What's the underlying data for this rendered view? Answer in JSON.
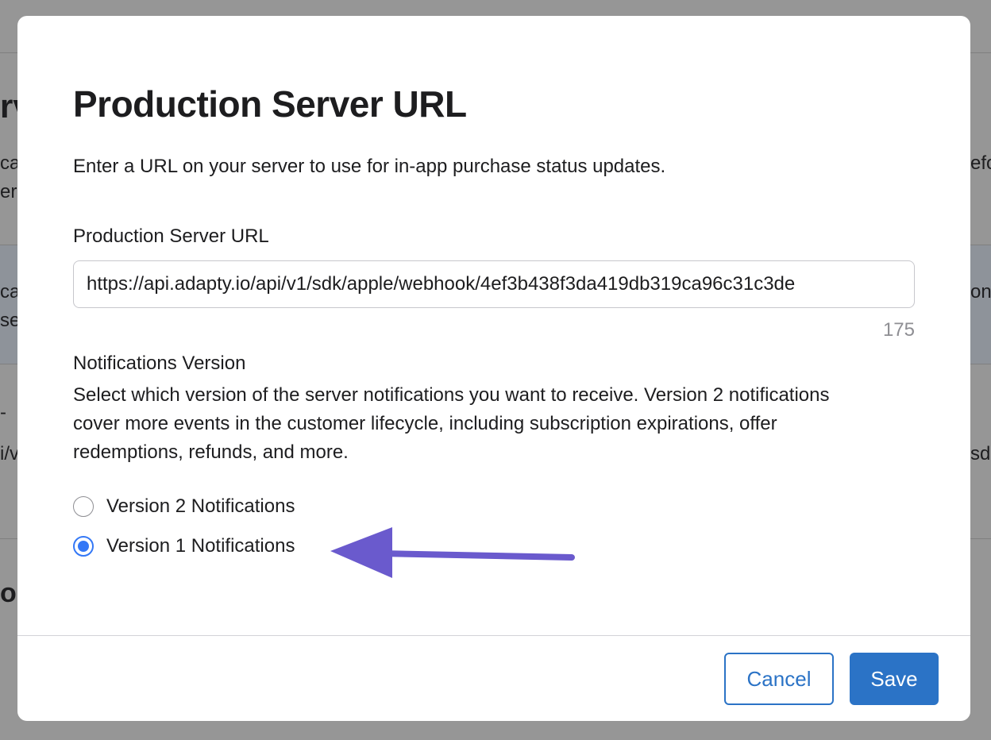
{
  "dialog": {
    "title": "Production Server URL",
    "description": "Enter a URL on your server to use for in-app purchase status updates.",
    "url_field": {
      "label": "Production Server URL",
      "value": "https://api.adapty.io/api/v1/sdk/apple/webhook/4ef3b438f3da419db319ca96c31c3de",
      "char_count": "175"
    },
    "notifications": {
      "title": "Notifications Version",
      "description": "Select which version of the server notifications you want to receive. Version 2 notifications cover more events in the customer lifecycle, including subscription expirations, offer redemptions, refunds, and more.",
      "options": [
        {
          "label": "Version 2 Notifications",
          "selected": false
        },
        {
          "label": "Version 1 Notifications",
          "selected": true
        }
      ]
    },
    "buttons": {
      "cancel": "Cancel",
      "save": "Save"
    }
  },
  "background": {
    "fragments": [
      "rv",
      "ca",
      "er",
      "ca",
      "se",
      "-",
      "i/v",
      "o",
      "efo",
      "ons",
      "sd"
    ]
  },
  "colors": {
    "accent": "#2b73c6",
    "radio_selected": "#3478f6",
    "annotation_arrow": "#6a5acd",
    "overlay": "#969696"
  }
}
